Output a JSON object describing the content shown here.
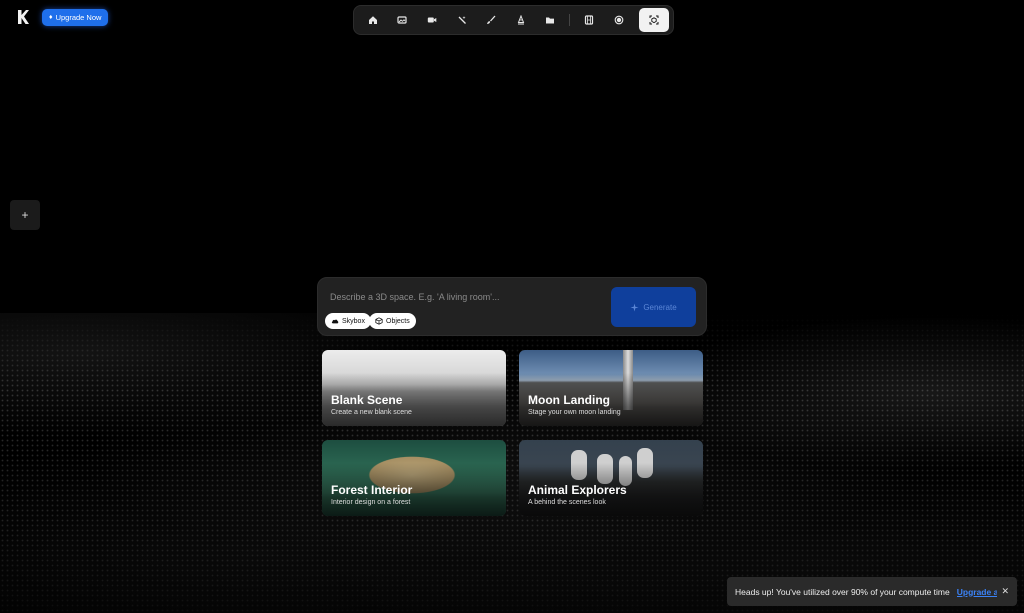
{
  "brand": {
    "logo_icon": "k-logo-icon"
  },
  "header": {
    "upgrade_label": "Upgrade Now",
    "upgrade_icon": "diamond-icon",
    "accent_color": "#1f6feb"
  },
  "toolbar": {
    "tools": [
      {
        "icon": "home-icon",
        "active": false
      },
      {
        "icon": "image-icon",
        "active": false
      },
      {
        "icon": "video-icon",
        "active": false
      },
      {
        "icon": "magic-wand-icon",
        "active": false
      },
      {
        "icon": "brush-icon",
        "active": false
      },
      {
        "icon": "pen-nib-icon",
        "active": false
      },
      {
        "icon": "folder-icon",
        "active": false
      },
      {
        "icon": "film-icon",
        "active": false
      },
      {
        "icon": "record-icon",
        "active": false
      },
      {
        "icon": "3d-scene-icon",
        "active": true
      }
    ]
  },
  "sidebar": {
    "add_label": "+"
  },
  "prompt": {
    "placeholder": "Describe a 3D space. E.g. 'A living room'...",
    "generate_label": "Generate",
    "chips": [
      {
        "label": "Skybox",
        "icon": "cloud-icon"
      },
      {
        "label": "Objects",
        "icon": "cube-icon"
      }
    ]
  },
  "templates": [
    {
      "title": "Blank Scene",
      "subtitle": "Create a new blank scene"
    },
    {
      "title": "Moon Landing",
      "subtitle": "Stage your own moon landing"
    },
    {
      "title": "Forest Interior",
      "subtitle": "Interior design on a forest"
    },
    {
      "title": "Animal Explorers",
      "subtitle": "A behind the scenes look"
    }
  ],
  "toast": {
    "message": "Heads up! You've utilized over 90% of your compute time",
    "link": "Upgrade a",
    "close": "✕"
  }
}
